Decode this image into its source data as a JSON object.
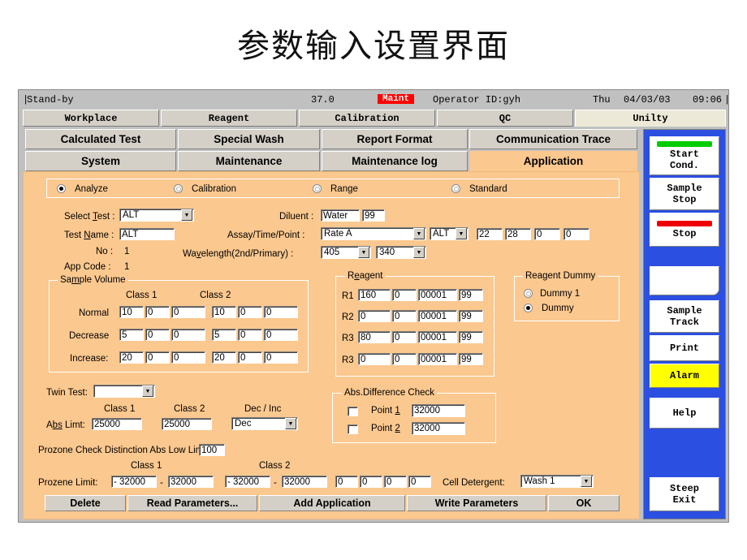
{
  "slide": {
    "title": "参数输入设置界面"
  },
  "status": {
    "left_pipe": "|",
    "state": "Stand-by",
    "temperature": "37.0",
    "maint_badge": "Maint",
    "operator": "Operator ID:gyh",
    "day": "Thu",
    "date": "04/03/03",
    "time": "09:06",
    "right_pipe": "|",
    "maint_color": "#ff0000"
  },
  "tabs_row1": [
    {
      "label": "Workplace",
      "active": false
    },
    {
      "label": "Reagent",
      "active": false
    },
    {
      "label": "Calibration",
      "active": false
    },
    {
      "label": "QC",
      "active": false
    },
    {
      "label": "Unilty",
      "active": true
    }
  ],
  "tabs_row2": [
    {
      "label": "Calculated Test",
      "active": false
    },
    {
      "label": "Special Wash",
      "active": false
    },
    {
      "label": "Report Format",
      "active": false
    },
    {
      "label": "Communication Trace",
      "active": false
    }
  ],
  "tabs_row3": [
    {
      "label": "System",
      "active": false
    },
    {
      "label": "Maintenance",
      "active": false
    },
    {
      "label": "Maintenance log",
      "active": false
    },
    {
      "label": "Application",
      "active": true
    }
  ],
  "mode_radios": [
    {
      "label": "Analyze",
      "selected": true
    },
    {
      "label": "Calibration",
      "selected": false
    },
    {
      "label": "Range",
      "selected": false
    },
    {
      "label": "Standard",
      "selected": false
    }
  ],
  "form": {
    "select_test_label": "Select Test :",
    "select_test_value": "ALT",
    "test_name_label": "Test Name :",
    "test_name_value": "ALT",
    "no_label": "No :",
    "no_value": "1",
    "app_code_label": "App Code :",
    "app_code_value": "1",
    "diluent_label": "Diluent :",
    "diluent_value": "Water",
    "diluent_num": "99",
    "assay_label": "Assay/Time/Point :",
    "assay_value": "Rate A",
    "assay_test": "ALT",
    "assay_p1": "22",
    "assay_p2": "28",
    "assay_p3": "0",
    "assay_p4": "0",
    "wavelength_label": "Wavelength(2nd/Primary) :",
    "wavelength_2nd": "405",
    "wavelength_primary": "340"
  },
  "sample_volume": {
    "title": "Sample Volume",
    "class1_label": "Class 1",
    "class2_label": "Class 2",
    "rows": [
      {
        "label": "Normal",
        "c1": [
          "10",
          "0",
          "0"
        ],
        "c2": [
          "10",
          "0",
          "0"
        ]
      },
      {
        "label": "Decrease",
        "c1": [
          "5",
          "0",
          "0"
        ],
        "c2": [
          "5",
          "0",
          "0"
        ]
      },
      {
        "label": "Increase:",
        "c1": [
          "20",
          "0",
          "0"
        ],
        "c2": [
          "20",
          "0",
          "0"
        ]
      }
    ]
  },
  "reagent": {
    "title": "Reagent",
    "rows": [
      {
        "label": "R1",
        "v": [
          "160",
          "0",
          "00001",
          "99"
        ]
      },
      {
        "label": "R2",
        "v": [
          "0",
          "0",
          "00001",
          "99"
        ]
      },
      {
        "label": "R3",
        "v": [
          "80",
          "0",
          "00001",
          "99"
        ]
      },
      {
        "label": "R3",
        "v": [
          "0",
          "0",
          "00001",
          "99"
        ]
      }
    ]
  },
  "reagent_dummy": {
    "title": "Reagent Dummy",
    "options": [
      {
        "label": "Dummy 1",
        "selected": false
      },
      {
        "label": "Dummy",
        "selected": true
      }
    ]
  },
  "twin": {
    "twin_test_label": "Twin Test:",
    "twin_test_value": "",
    "class1_label": "Class 1",
    "class2_label": "Class 2",
    "decinc_label": "Dec / Inc",
    "abs_limt_label": "Abs Limt:",
    "abs_limt_c1": "25000",
    "abs_limt_c2": "25000",
    "decinc_value": "Dec"
  },
  "abs_diff": {
    "title": "Abs.Difference Check",
    "point1_label": "Point 1",
    "point1_value": "32000",
    "point1_checked": false,
    "point2_label": "Point 2",
    "point2_value": "32000",
    "point2_checked": false
  },
  "prozone": {
    "low_limit_label": "Prozone Check Distinction Abs Low Limit:",
    "low_limit_value": "100",
    "class1_label": "Class 1",
    "class2_label": "Class 2",
    "limit_label": "Prozene Limit:",
    "c1_lo": "- 32000",
    "c1_dash": "-",
    "c1_hi": "32000",
    "c2_lo": "- 32000",
    "c2_dash": "-",
    "c2_hi": "32000",
    "extra": [
      "0",
      "0",
      "0",
      "0"
    ],
    "cell_detergent_label": "Cell Detergent:",
    "cell_detergent_value": "Wash 1"
  },
  "bottom_buttons": [
    {
      "label": "Delete"
    },
    {
      "label": "Read Parameters..."
    },
    {
      "label": "Add Application"
    },
    {
      "label": "Write Parameters"
    },
    {
      "label": "OK"
    }
  ],
  "sidebar": {
    "buttons": [
      {
        "line1": "Start",
        "line2": "Cond.",
        "bar": "#00cc00",
        "style": "normal"
      },
      {
        "line1": "Sample",
        "line2": "Stop",
        "bar": "",
        "style": "normal"
      },
      {
        "line1": "Stop",
        "line2": "",
        "bar": "#ee0000",
        "style": "normal"
      },
      {
        "line1": "",
        "line2": "",
        "bar": "",
        "style": "blank"
      },
      {
        "line1": "Sample",
        "line2": "Track",
        "bar": "",
        "style": "normal"
      },
      {
        "line1": "Print",
        "line2": "",
        "bar": "",
        "style": "normal"
      },
      {
        "line1": "Alarm",
        "line2": "",
        "bar": "",
        "style": "yellow"
      },
      {
        "line1": "Help",
        "line2": "",
        "bar": "",
        "style": "normal"
      },
      {
        "line1": "Steep",
        "line2": "Exit",
        "bar": "",
        "style": "normal"
      }
    ],
    "background_color": "#2b4fe0"
  }
}
